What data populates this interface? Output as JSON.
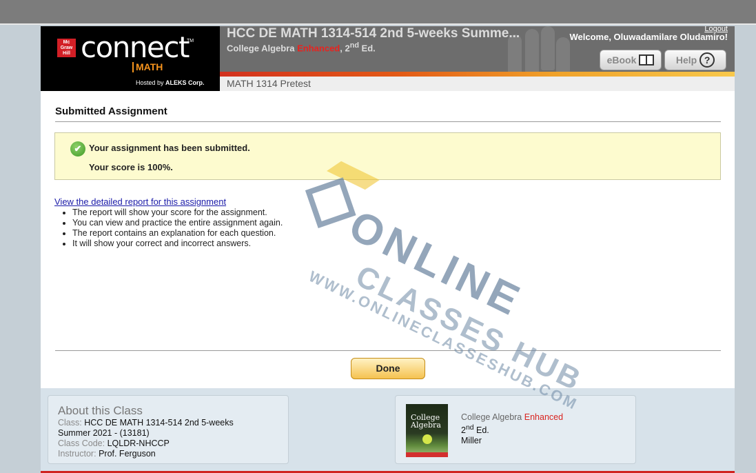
{
  "header": {
    "brand": {
      "mh_logo": "Mc Graw Hill",
      "connect": "connect",
      "trademark": "TM",
      "product": "MATH",
      "hosted_by_prefix": "Hosted by",
      "hosted_by_company": "ALEKS Corp."
    },
    "course_title": "HCC DE MATH 1314-514 2nd 5-weeks Summe...",
    "subtitle_part1": "College Algebra",
    "subtitle_enhanced": "Enhanced",
    "subtitle_part2": ", 2",
    "subtitle_sup": "nd",
    "subtitle_part3": " Ed.",
    "logout": "Logout",
    "welcome": "Welcome, Oluwadamilare Oludamiro!",
    "ebook_label": "eBook",
    "help_label": "Help",
    "help_glyph": "?",
    "subnav": "MATH 1314 Pretest",
    "colors": {
      "accent_red": "#d0221f",
      "enhanced_red": "#e8231f",
      "link_blue": "#1a1aa8"
    }
  },
  "main": {
    "title": "Submitted Assignment",
    "notice_check": "✔",
    "notice_line1": "Your assignment has been submitted.",
    "notice_line2": "Your score is 100%.",
    "report_link": "View the detailed report for this assignment",
    "bullets": [
      "The report will show your score for the assignment.",
      "You can view and practice the entire assignment again.",
      "The report contains an explanation for each question.",
      "It will show your correct and incorrect answers."
    ],
    "done_label": "Done"
  },
  "footer": {
    "about_title": "About this Class",
    "class_key": "Class:",
    "class_value": "HCC DE MATH 1314-514 2nd 5-weeks",
    "class_value2": "Summer 2021 - (13181)",
    "code_key": "Class Code:",
    "code_value": "LQLDR-NHCCP",
    "instructor_key": "Instructor:",
    "instructor_value": "Prof. Ferguson",
    "cover_line1": "College",
    "cover_line2": "Algebra",
    "book_title": "College Algebra",
    "book_enhanced": "Enhanced",
    "book_edition_num": "2",
    "book_edition_sup": "nd",
    "book_edition_suffix": " Ed.",
    "book_author": "Miller"
  },
  "watermark": {
    "line1": "ONLINE",
    "line2": "CLASSES HUB",
    "url": "WWW.ONLINECLASSESHUB.COM"
  }
}
